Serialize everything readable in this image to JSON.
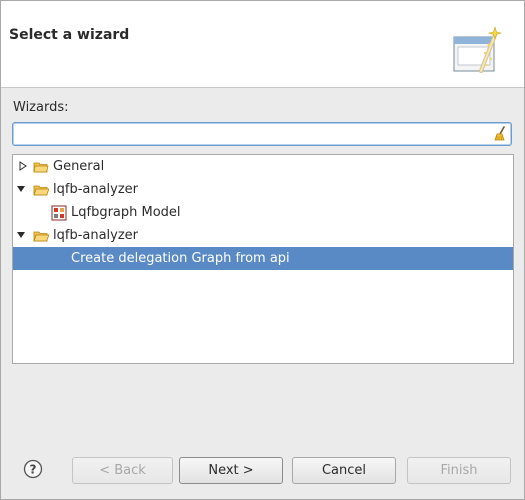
{
  "header": {
    "title": "Select a wizard",
    "icon": "wizard-banner-icon"
  },
  "wizards": {
    "label": "Wizards:",
    "filter_value": "",
    "clear_icon": "broom-clear-icon"
  },
  "tree": {
    "items": [
      {
        "label": "General",
        "expanded": false,
        "icon": "folder-icon"
      },
      {
        "label": "lqfb-analyzer",
        "expanded": true,
        "icon": "folder-open-icon"
      },
      {
        "label": "Lqfbgraph Model",
        "icon": "model-icon"
      },
      {
        "label": "lqfb-analyzer",
        "expanded": true,
        "icon": "folder-open-icon"
      },
      {
        "label": "Create delegation Graph from api",
        "selected": true
      }
    ]
  },
  "buttons": {
    "back": "< Back",
    "next": "Next >",
    "cancel": "Cancel",
    "finish": "Finish",
    "help_icon": "help-icon"
  },
  "colors": {
    "selection": "#5a8ac6",
    "focus_border": "#6b9bd1",
    "dialog_bg": "#ebebeb"
  }
}
